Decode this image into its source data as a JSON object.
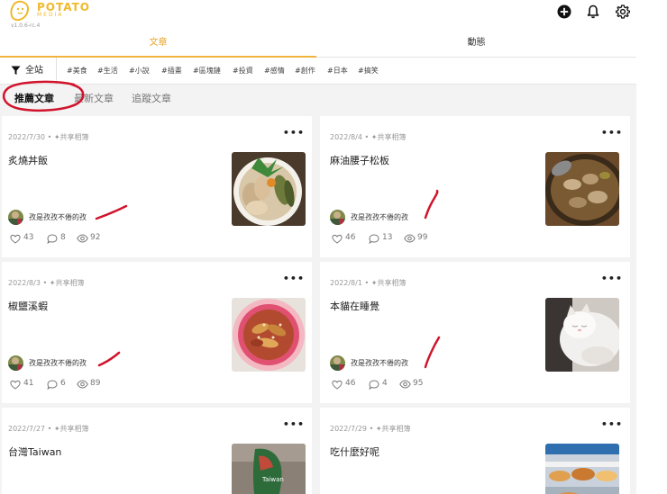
{
  "header": {
    "logo_text": "POTATO",
    "logo_sub": "MEDIA",
    "version": "v1.0.6-rc.4",
    "icons": [
      "add-circle-icon",
      "bell-icon",
      "gear-icon"
    ]
  },
  "main_tabs": [
    {
      "label": "文章",
      "active": true
    },
    {
      "label": "動態",
      "active": false
    }
  ],
  "filter": {
    "all_label": "全站",
    "tags": [
      "#美食",
      "#生活",
      "#小說",
      "#插畫",
      "#區塊鏈",
      "#投資",
      "#感情",
      "#創作",
      "#日本",
      "#搞笑"
    ]
  },
  "sub_tabs": [
    {
      "label": "推薦文章",
      "active": true
    },
    {
      "label": "最新文章",
      "active": false
    },
    {
      "label": "追蹤文章",
      "active": false
    }
  ],
  "more_label": "•••",
  "cards": [
    {
      "date": "2022/7/30",
      "category": "• ✦共享相簿",
      "title": "炙燒丼飯",
      "author": "孜是孜孜不倦的孜",
      "likes": "43",
      "comments": "8",
      "views": "92",
      "thumb": "food-plate"
    },
    {
      "date": "2022/8/4",
      "category": "• ✦共享相簿",
      "title": "麻油腰子松板",
      "author": "孜是孜孜不倦的孜",
      "likes": "46",
      "comments": "13",
      "views": "99",
      "thumb": "pot-dish"
    },
    {
      "date": "2022/8/3",
      "category": "• ✦共享相簿",
      "title": "椒鹽溪蝦",
      "author": "孜是孜孜不倦的孜",
      "likes": "41",
      "comments": "6",
      "views": "89",
      "thumb": "shrimp-plate"
    },
    {
      "date": "2022/8/1",
      "category": "• ✦共享相簿",
      "title": "本貓在睡覺",
      "author": "孜是孜孜不倦的孜",
      "likes": "46",
      "comments": "4",
      "views": "95",
      "thumb": "sleeping-cat"
    },
    {
      "date": "2022/7/27",
      "category": "• ✦共享相簿",
      "title": "台灣Taiwan",
      "thumb": "taiwan-sign"
    },
    {
      "date": "2022/7/29",
      "category": "• ✦共享相簿",
      "title": "吃什麼好呢",
      "thumb": "food-display"
    }
  ],
  "colors": {
    "accent": "#f1b33b",
    "annotation": "#d0142c",
    "background": "#f3f3f3"
  }
}
